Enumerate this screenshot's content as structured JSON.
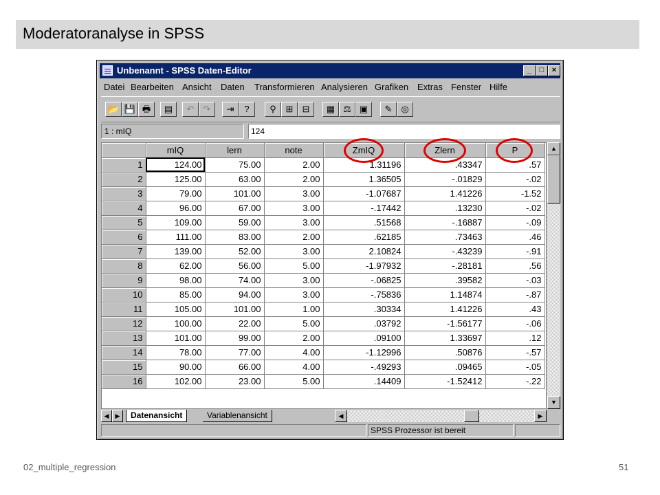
{
  "slide": {
    "title": "Moderatoranalyse in SPSS",
    "footer_left": "02_multiple_regression",
    "page_number": "51"
  },
  "window": {
    "title": "Unbenannt - SPSS Daten-Editor",
    "controls": {
      "minimize": "_",
      "maximize": "□",
      "close": "×"
    }
  },
  "menu": [
    "Datei",
    "Bearbeiten",
    "Ansicht",
    "Daten",
    "Transformieren",
    "Analysieren",
    "Grafiken",
    "Extras",
    "Fenster",
    "Hilfe"
  ],
  "toolbar": {
    "icons": [
      "open-icon",
      "save-icon",
      "print-icon",
      "dialog-recall-icon",
      "undo-icon",
      "redo-icon",
      "goto-case-icon",
      "variables-icon",
      "find-icon",
      "insert-case-icon",
      "insert-variable-icon",
      "split-file-icon",
      "weight-cases-icon",
      "select-cases-icon",
      "value-labels-icon",
      "use-sets-icon"
    ],
    "glyphs": [
      "📂",
      "💾",
      "🖶",
      "▤",
      "↶",
      "↷",
      "⇥",
      "?",
      "⚲",
      "⊞",
      "⊟",
      "▦",
      "⚖",
      "▣",
      "✎",
      "◎"
    ]
  },
  "cell_editor": {
    "reference": "1 : mIQ",
    "value": "124"
  },
  "grid": {
    "columns": [
      "mIQ",
      "lern",
      "note",
      "ZmIQ",
      "Zlern",
      "P"
    ],
    "highlighted_columns": [
      "ZmIQ",
      "Zlern",
      "P"
    ],
    "rows": [
      [
        "1",
        "124.00",
        "75.00",
        "2.00",
        "1.31196",
        ".43347",
        ".57"
      ],
      [
        "2",
        "125.00",
        "63.00",
        "2.00",
        "1.36505",
        "-.01829",
        "-.02"
      ],
      [
        "3",
        "79.00",
        "101.00",
        "3.00",
        "-1.07687",
        "1.41226",
        "-1.52"
      ],
      [
        "4",
        "96.00",
        "67.00",
        "3.00",
        "-.17442",
        ".13230",
        "-.02"
      ],
      [
        "5",
        "109.00",
        "59.00",
        "3.00",
        ".51568",
        "-.16887",
        "-.09"
      ],
      [
        "6",
        "111.00",
        "83.00",
        "2.00",
        ".62185",
        ".73463",
        ".46"
      ],
      [
        "7",
        "139.00",
        "52.00",
        "3.00",
        "2.10824",
        "-.43239",
        "-.91"
      ],
      [
        "8",
        "62.00",
        "56.00",
        "5.00",
        "-1.97932",
        "-.28181",
        ".56"
      ],
      [
        "9",
        "98.00",
        "74.00",
        "3.00",
        "-.06825",
        ".39582",
        "-.03"
      ],
      [
        "10",
        "85.00",
        "94.00",
        "3.00",
        "-.75836",
        "1.14874",
        "-.87"
      ],
      [
        "11",
        "105.00",
        "101.00",
        "1.00",
        ".30334",
        "1.41226",
        ".43"
      ],
      [
        "12",
        "100.00",
        "22.00",
        "5.00",
        ".03792",
        "-1.56177",
        "-.06"
      ],
      [
        "13",
        "101.00",
        "99.00",
        "2.00",
        ".09100",
        "1.33697",
        ".12"
      ],
      [
        "14",
        "78.00",
        "77.00",
        "4.00",
        "-1.12996",
        ".50876",
        "-.57"
      ],
      [
        "15",
        "90.00",
        "66.00",
        "4.00",
        "-.49293",
        ".09465",
        "-.05"
      ],
      [
        "16",
        "102.00",
        "23.00",
        "5.00",
        ".14409",
        "-1.52412",
        "-.22"
      ]
    ]
  },
  "tabs": {
    "data_view": "Datenansicht",
    "variable_view": "Variablenansicht"
  },
  "status": {
    "processor": "SPSS Prozessor  ist bereit"
  },
  "colors": {
    "titlebar": "#0a246a",
    "highlight_circle": "#e00000",
    "chrome": "#c0c0c0"
  }
}
